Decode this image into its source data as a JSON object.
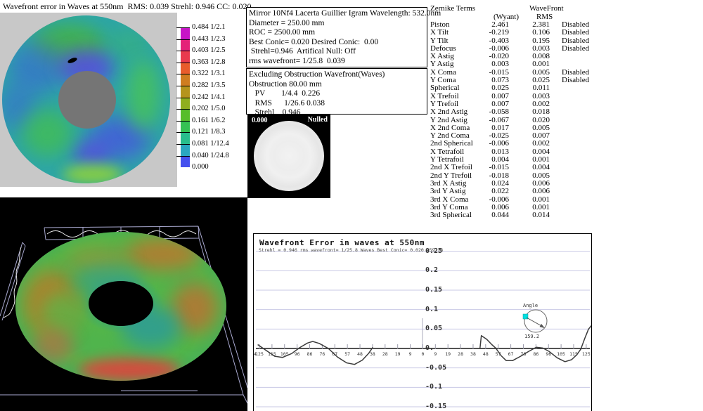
{
  "map2d": {
    "title": "Wavefront error in Waves at 550nm  RMS: 0.039 Strehl: 0.946 CC: 0.020",
    "scale_labels": [
      "0.484 1/2.1",
      "0.443 1/2.3",
      "0.403 1/2.5",
      "0.363 1/2.8",
      "0.322 1/3.1",
      "0.282 1/3.5",
      "0.242 1/4.1",
      "0.202 1/5.0",
      "0.161 1/6.2",
      "0.121 1/8.3",
      "0.081 1/12.4",
      "0.040 1/24.8",
      "0.000"
    ],
    "scale_colors": [
      "#c714c7",
      "#e42278",
      "#e93a4e",
      "#e85c2c",
      "#cf7d20",
      "#b5941c",
      "#8fae1e",
      "#57bd2a",
      "#35c153",
      "#28bd8c",
      "#2aa6c0",
      "#4550ee"
    ]
  },
  "info_primary": {
    "lines": [
      "Mirror 10Nf4 Lacerta Guillier Igram Wavelength: 532.0nm",
      "Diameter = 250.00 mm",
      "ROC = 2500.00 mm",
      "Best Conic= 0.020 Desired Conic:  0.00",
      " Strehl=0.946  Artifical Null: Off",
      "rms wavefront= 1/25.8  0.039"
    ]
  },
  "info_obstruction": {
    "lines": [
      "Excluding Obstruction Wavefront(Waves)",
      "Obstruction 80.00 mm",
      "   PV        1/4.4  0.226",
      "   RMS      1/26.6 0.038",
      "   Strehl    0.946"
    ]
  },
  "nulled_view": {
    "value_label": "0.000",
    "status_label": "Nulled"
  },
  "zernike": {
    "title": "Zernike Terms",
    "col_group": "WaveFront",
    "col_wyant": "(Wyant)",
    "col_rms": "RMS",
    "disabled_text": "Disabled",
    "rows": [
      {
        "name": "Piston",
        "wyant": "2.461",
        "rms": "2.381",
        "disabled": true
      },
      {
        "name": "X Tilt",
        "wyant": "-0.219",
        "rms": "0.106",
        "disabled": true
      },
      {
        "name": "Y Tilt",
        "wyant": "-0.403",
        "rms": "0.195",
        "disabled": true
      },
      {
        "name": "Defocus",
        "wyant": "-0.006",
        "rms": "0.003",
        "disabled": true
      },
      {
        "name": "X Astig",
        "wyant": "-0.020",
        "rms": "0.008",
        "disabled": false
      },
      {
        "name": "Y Astig",
        "wyant": "0.003",
        "rms": "0.001",
        "disabled": false
      },
      {
        "name": "X Coma",
        "wyant": "-0.015",
        "rms": "0.005",
        "disabled": true
      },
      {
        "name": "Y Coma",
        "wyant": "0.073",
        "rms": "0.025",
        "disabled": true
      },
      {
        "name": "Spherical",
        "wyant": "0.025",
        "rms": "0.011",
        "disabled": false
      },
      {
        "name": "X Trefoil",
        "wyant": "0.007",
        "rms": "0.003",
        "disabled": false
      },
      {
        "name": "Y Trefoil",
        "wyant": "0.007",
        "rms": "0.002",
        "disabled": false
      },
      {
        "name": "X 2nd Astig",
        "wyant": "-0.058",
        "rms": "0.018",
        "disabled": false
      },
      {
        "name": "Y 2nd Astig",
        "wyant": "-0.067",
        "rms": "0.020",
        "disabled": false
      },
      {
        "name": "X 2nd Coma",
        "wyant": "0.017",
        "rms": "0.005",
        "disabled": false
      },
      {
        "name": "Y 2nd Coma",
        "wyant": "-0.025",
        "rms": "0.007",
        "disabled": false
      },
      {
        "name": "2nd Spherical",
        "wyant": "-0.006",
        "rms": "0.002",
        "disabled": false
      },
      {
        "name": "X Tetrafoil",
        "wyant": "0.013",
        "rms": "0.004",
        "disabled": false
      },
      {
        "name": "Y Tetrafoil",
        "wyant": "0.004",
        "rms": "0.001",
        "disabled": false
      },
      {
        "name": "2nd X Trefoil",
        "wyant": "-0.015",
        "rms": "0.004",
        "disabled": false
      },
      {
        "name": "2nd Y Trefoil",
        "wyant": "-0.018",
        "rms": "0.005",
        "disabled": false
      },
      {
        "name": "3rd X Astig",
        "wyant": "0.024",
        "rms": "0.006",
        "disabled": false
      },
      {
        "name": "3rd Y Astig",
        "wyant": "0.022",
        "rms": "0.006",
        "disabled": false
      },
      {
        "name": "3rd X Coma",
        "wyant": "-0.006",
        "rms": "0.001",
        "disabled": false
      },
      {
        "name": "3rd Y Coma",
        "wyant": "0.006",
        "rms": "0.001",
        "disabled": false
      },
      {
        "name": "3rd Spherical",
        "wyant": "0.044",
        "rms": "0.014",
        "disabled": false
      }
    ]
  },
  "profile_chart": {
    "title": "Wavefront Error in waves at 550nm",
    "subtitle": "Strehl = 0.946 rms wavefront= 1/25.8 Waves Best Conic= 0.020 159.18",
    "angle_widget": {
      "label": "Angle",
      "value": "159.2",
      "marker_color": "#00e0e0"
    }
  },
  "chart_data": {
    "type": "line",
    "title": "Wavefront Error in waves at 550nm",
    "subtitle": "Strehl = 0.946 rms wavefront= 1/25.8 Waves Best Conic= 0.020 159.18",
    "xlabel": "",
    "ylabel": "",
    "ylim": [
      -0.15,
      0.25
    ],
    "grid": true,
    "y_ticks": [
      "0.25",
      "0.2",
      "0.15",
      "0.1",
      "0.05",
      "0.",
      "-0.05",
      "-0.1",
      "-0.15"
    ],
    "y_tick_values": [
      0.25,
      0.2,
      0.15,
      0.1,
      0.05,
      0,
      -0.05,
      -0.1,
      -0.15
    ],
    "x_tick_labels": [
      "4",
      "125",
      "115",
      "105",
      "96",
      "86",
      "76",
      "67",
      "57",
      "48",
      "38",
      "28",
      "19",
      "9",
      "0",
      "9",
      "19",
      "28",
      "38",
      "48",
      "57",
      "67",
      "76",
      "86",
      "96",
      "105",
      "115",
      "125"
    ],
    "series": [
      {
        "name": "profile-left-radius",
        "points": [
          [
            -126,
            0.01
          ],
          [
            -120,
            -0.004
          ],
          [
            -113,
            -0.02
          ],
          [
            -107,
            -0.023
          ],
          [
            -100,
            -0.013
          ],
          [
            -94,
            0.002
          ],
          [
            -88,
            0.014
          ],
          [
            -84,
            0.018
          ],
          [
            -79,
            0.013
          ],
          [
            -72,
            0.0
          ],
          [
            -65,
            -0.022
          ],
          [
            -58,
            -0.037
          ],
          [
            -52,
            -0.041
          ],
          [
            -46,
            -0.03
          ],
          [
            -41,
            -0.012
          ],
          [
            -38,
            0.003
          ]
        ]
      },
      {
        "name": "profile-right-radius",
        "points": [
          [
            44,
            0.001
          ],
          [
            45,
            0.033
          ],
          [
            49,
            0.024
          ],
          [
            53,
            0.01
          ],
          [
            56,
            0.001
          ],
          [
            60,
            -0.018
          ],
          [
            64,
            -0.031
          ],
          [
            69,
            -0.031
          ],
          [
            75,
            -0.02
          ],
          [
            81,
            -0.008
          ],
          [
            87,
            0.003
          ],
          [
            92,
            0.001
          ],
          [
            97,
            -0.008
          ],
          [
            103,
            -0.024
          ],
          [
            109,
            -0.034
          ],
          [
            114,
            -0.029
          ],
          [
            118,
            -0.016
          ],
          [
            121,
            -0.002
          ],
          [
            124,
            0.025
          ],
          [
            127,
            0.05
          ],
          [
            130,
            0.062
          ]
        ]
      }
    ]
  }
}
